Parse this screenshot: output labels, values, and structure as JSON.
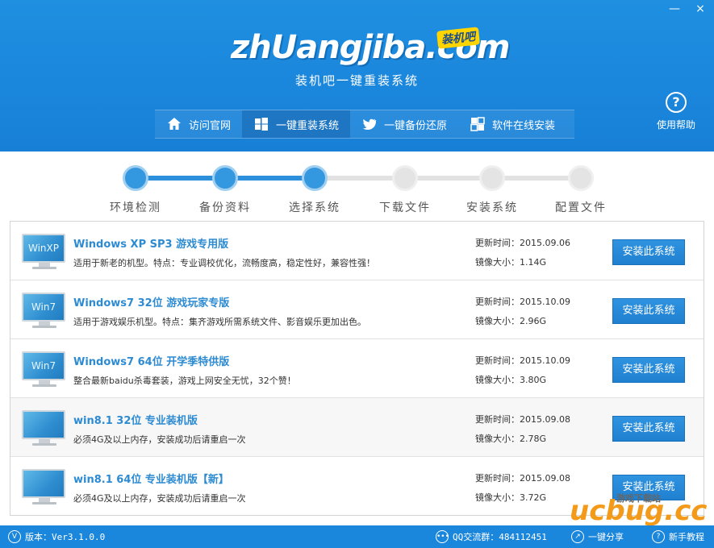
{
  "window": {
    "minimize_label": "—",
    "close_label": "×"
  },
  "header": {
    "logo_text": "zhUangjiba.com",
    "logo_badge": "装机吧",
    "subtitle": "装机吧一键重装系统",
    "help_label": "使用帮助",
    "help_glyph": "?"
  },
  "nav": [
    {
      "label": "访问官网",
      "icon": "home-icon",
      "active": false
    },
    {
      "label": "一键重装系统",
      "icon": "windows-icon",
      "active": true
    },
    {
      "label": "一键备份还原",
      "icon": "bird-icon",
      "active": false
    },
    {
      "label": "软件在线安装",
      "icon": "grid-icon",
      "active": false
    }
  ],
  "steps": [
    {
      "label": "环境检测",
      "done": true
    },
    {
      "label": "备份资料",
      "done": true
    },
    {
      "label": "选择系统",
      "done": true
    },
    {
      "label": "下载文件",
      "done": false
    },
    {
      "label": "安装系统",
      "done": false
    },
    {
      "label": "配置文件",
      "done": false
    }
  ],
  "systems": [
    {
      "badge": "WinXP",
      "title": "Windows XP SP3 游戏专用版",
      "desc": "适用于新老的机型。特点：专业调校优化，流畅度高，稳定性好，兼容性强！",
      "updated": "更新时间：2015.09.06",
      "size": "镜像大小：1.14G",
      "button": "安装此系统"
    },
    {
      "badge": "Win7",
      "title": "Windows7 32位 游戏玩家专版",
      "desc": "适用于游戏娱乐机型。特点：集齐游戏所需系统文件、影音娱乐更加出色。",
      "updated": "更新时间：2015.10.09",
      "size": "镜像大小：2.96G",
      "button": "安装此系统"
    },
    {
      "badge": "Win7",
      "title": "Windows7 64位 开学季特供版",
      "desc": "整合最新baidu杀毒套装，游戏上网安全无忧，32个赞！",
      "updated": "更新时间：2015.10.09",
      "size": "镜像大小：3.80G",
      "button": "安装此系统"
    },
    {
      "badge": "",
      "title": "win8.1 32位 专业装机版",
      "desc": "必须4G及以上内存，安装成功后请重启一次",
      "updated": "更新时间：2015.09.08",
      "size": "镜像大小：2.78G",
      "button": "安装此系统"
    },
    {
      "badge": "",
      "title": "win8.1 64位 专业装机版【新】",
      "desc": "必须4G及以上内存，安装成功后请重启一次",
      "updated": "更新时间：2015.09.08",
      "size": "镜像大小：3.72G",
      "button": "安装此系统"
    }
  ],
  "footer": {
    "version": "版本：Ver3.1.0.0",
    "version_icon": "V",
    "qq": "QQ交流群：484112451",
    "share": "一键分享",
    "tutorial": "新手教程"
  },
  "watermark": {
    "big": "ucbug.cc",
    "small": "游戏下载站"
  },
  "colors": {
    "brand_blue": "#1a86dc",
    "title_blue": "#2d8bd2",
    "step_done": "#3498e0",
    "step_pending": "#e4e4e4"
  }
}
